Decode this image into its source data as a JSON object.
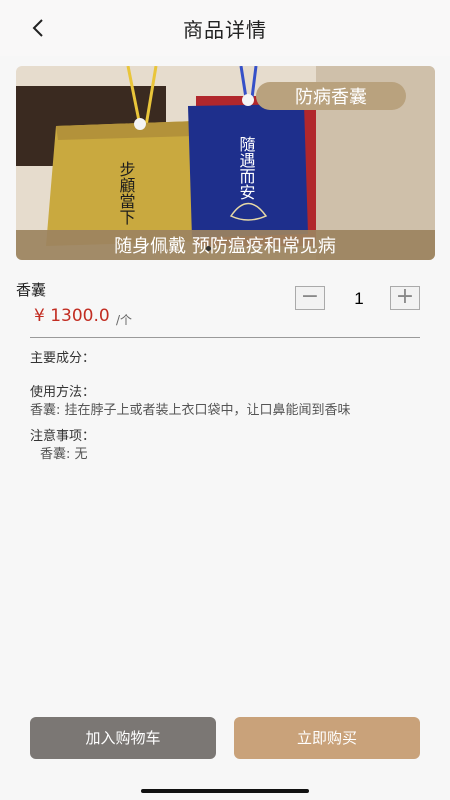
{
  "header": {
    "back_icon": "chevron-left-icon",
    "title": "商品详情"
  },
  "hero": {
    "banner_top": "防病香囊",
    "banner_bottom": "随身佩戴  预防瘟疫和常见病",
    "pouch_left_text": "步顧當下",
    "pouch_right_text": "隨遇而安"
  },
  "product": {
    "name": "香囊",
    "price": "¥ 1300.0",
    "unit": "/个"
  },
  "quantity": {
    "minus_label": "−",
    "plus_label": "+",
    "value": "1"
  },
  "details": {
    "ingredients_label": "主要成分：",
    "usage_label": "使用方法：",
    "usage_text": "香囊:  挂在脖子上或者装上衣口袋中，让口鼻能闻到香味",
    "notes_label": "注意事项：",
    "notes_text": "香囊:  无"
  },
  "actions": {
    "add_to_cart": "加入购物车",
    "buy_now": "立即购买"
  },
  "colors": {
    "price": "#c22d22",
    "cart_button": "#7b7774",
    "buy_button": "#c9a27a"
  }
}
